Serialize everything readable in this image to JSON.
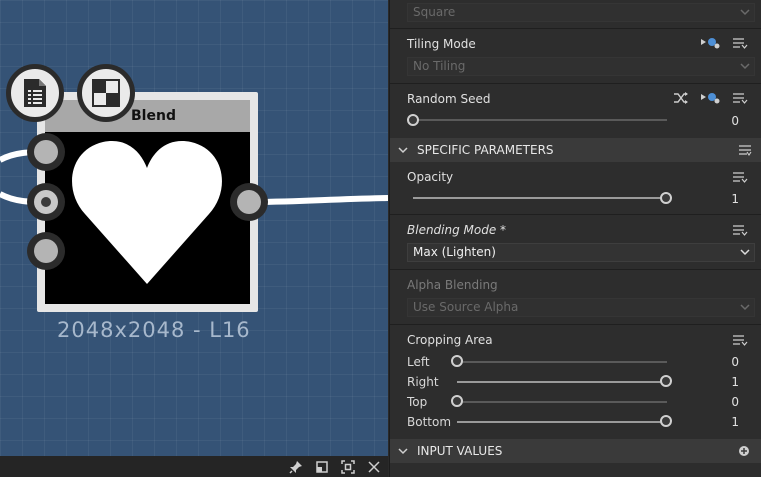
{
  "graph": {
    "node_title": "Blend",
    "resolution_label": "2048x2048 - L16"
  },
  "panel": {
    "top_dropdown": "Square",
    "tiling_mode": {
      "label": "Tiling Mode",
      "value": "No Tiling"
    },
    "random_seed": {
      "label": "Random Seed",
      "value": "0",
      "fraction": 0
    },
    "specific_section": "SPECIFIC PARAMETERS",
    "opacity": {
      "label": "Opacity",
      "value": "1",
      "fraction": 1
    },
    "blending_mode": {
      "label": "Blending Mode *",
      "value": "Max (Lighten)"
    },
    "alpha_blending": {
      "label": "Alpha Blending",
      "value": "Use Source Alpha"
    },
    "cropping_area": {
      "label": "Cropping Area",
      "rows": [
        {
          "label": "Left",
          "value": "0",
          "fraction": 0
        },
        {
          "label": "Right",
          "value": "1",
          "fraction": 1
        },
        {
          "label": "Top",
          "value": "0",
          "fraction": 0
        },
        {
          "label": "Bottom",
          "value": "1",
          "fraction": 1
        }
      ]
    },
    "input_section": "INPUT VALUES"
  },
  "colors": {
    "canvas_bg": "#355376",
    "panel_bg": "#2d2d2d",
    "section_bg": "#3a3a3a"
  }
}
